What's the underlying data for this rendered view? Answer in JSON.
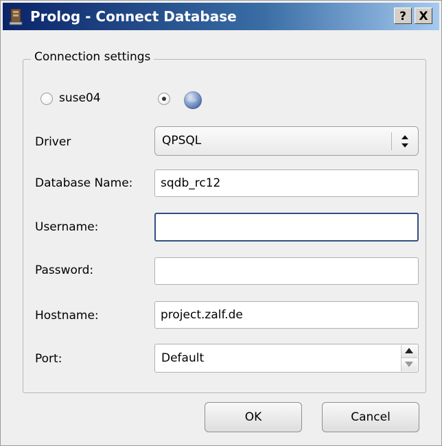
{
  "window": {
    "title": "Prolog - Connect Database",
    "help_label": "?",
    "close_label": "X"
  },
  "group": {
    "title": "Connection settings"
  },
  "radios": {
    "option1_label": "suse04",
    "option1_selected": false,
    "option2_selected": true,
    "option2_icon": "globe-icon"
  },
  "form": {
    "driver_label": "Driver",
    "driver_value": "QPSQL",
    "database_label": "Database Name:",
    "database_value": "sqdb_rc12",
    "username_label": "Username:",
    "username_value": "",
    "password_label": "Password:",
    "password_value": "",
    "hostname_label": "Hostname:",
    "hostname_value": "project.zalf.de",
    "port_label": "Port:",
    "port_value": "Default"
  },
  "buttons": {
    "ok": "OK",
    "cancel": "Cancel"
  }
}
